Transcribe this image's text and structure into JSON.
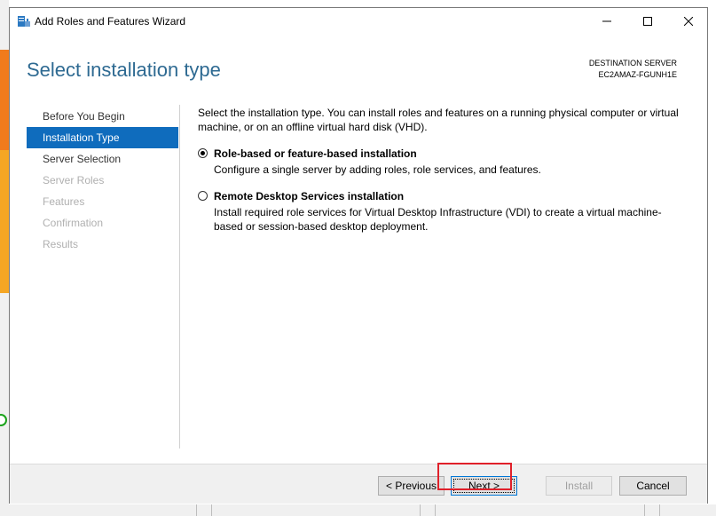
{
  "window": {
    "title": "Add Roles and Features Wizard",
    "app_icon": "server-manager-icon",
    "controls": {
      "minimize_icon": "minimize-icon",
      "maximize_icon": "maximize-icon",
      "close_icon": "close-icon"
    }
  },
  "header": {
    "page_title": "Select installation type",
    "destination_label": "DESTINATION SERVER",
    "destination_server": "EC2AMAZ-FGUNH1E"
  },
  "nav": {
    "items": [
      {
        "label": "Before You Begin",
        "state": "normal"
      },
      {
        "label": "Installation Type",
        "state": "active"
      },
      {
        "label": "Server Selection",
        "state": "normal"
      },
      {
        "label": "Server Roles",
        "state": "disabled"
      },
      {
        "label": "Features",
        "state": "disabled"
      },
      {
        "label": "Confirmation",
        "state": "disabled"
      },
      {
        "label": "Results",
        "state": "disabled"
      }
    ]
  },
  "content": {
    "intro": "Select the installation type. You can install roles and features on a running physical computer or virtual machine, or on an offline virtual hard disk (VHD).",
    "options": [
      {
        "title": "Role-based or feature-based installation",
        "description": "Configure a single server by adding roles, role services, and features.",
        "selected": true
      },
      {
        "title": "Remote Desktop Services installation",
        "description": "Install required role services for Virtual Desktop Infrastructure (VDI) to create a virtual machine-based or session-based desktop deployment.",
        "selected": false
      }
    ]
  },
  "footer": {
    "previous_label": "< Previous",
    "next_label": "Next >",
    "install_label": "Install",
    "cancel_label": "Cancel"
  },
  "colors": {
    "title_blue": "#2e6a92",
    "nav_active": "#0f6cbd",
    "highlight_red": "#e0202a",
    "bg_orange": "#f07b1c"
  }
}
